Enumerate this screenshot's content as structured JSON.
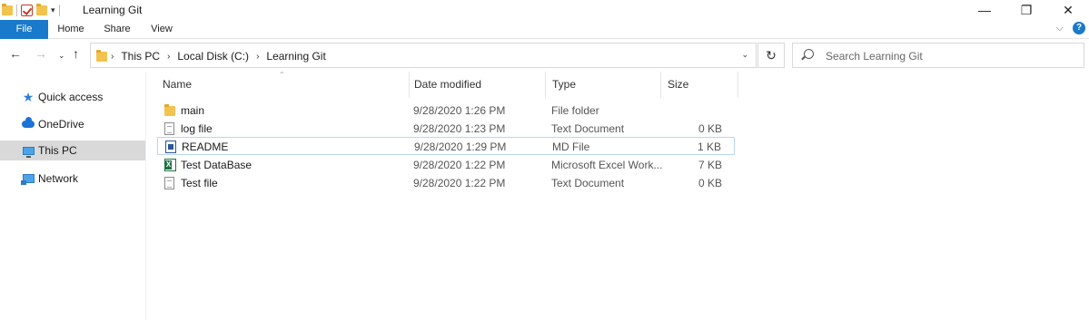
{
  "window": {
    "title": "Learning Git",
    "controls": {
      "minimize": "—",
      "restore": "❐",
      "close": "✕"
    }
  },
  "quick_access_toolbar": {
    "dropdown": "▾"
  },
  "ribbon": {
    "tabs": [
      "File",
      "Home",
      "Share",
      "View"
    ],
    "file_tab_color": "#1979ca",
    "expand_chevron": "⌵",
    "help": "?"
  },
  "navigation": {
    "back": "←",
    "forward": "→",
    "recent": "⌄",
    "up": "↑",
    "breadcrumb": [
      "This PC",
      "Local Disk (C:)",
      "Learning Git"
    ],
    "breadcrumb_separator": "›",
    "address_dropdown": "⌄",
    "refresh": "↻",
    "search_placeholder": "Search Learning Git"
  },
  "sidebar": {
    "items": [
      {
        "label": "Quick access",
        "icon": "star-icon"
      },
      {
        "label": "OneDrive",
        "icon": "cloud-icon"
      },
      {
        "label": "This PC",
        "icon": "computer-icon",
        "selected": true
      },
      {
        "label": "Network",
        "icon": "network-icon"
      }
    ]
  },
  "file_list": {
    "columns": [
      "Name",
      "Date modified",
      "Type",
      "Size"
    ],
    "sort_indicator": "⌃",
    "rows": [
      {
        "name": "main",
        "date": "9/28/2020 1:26 PM",
        "type": "File folder",
        "size": "",
        "icon": "folder-icon"
      },
      {
        "name": "log file",
        "date": "9/28/2020 1:23 PM",
        "type": "Text Document",
        "size": "0 KB",
        "icon": "text-document-icon"
      },
      {
        "name": "README",
        "date": "9/28/2020 1:29 PM",
        "type": "MD File",
        "size": "1 KB",
        "icon": "md-file-icon",
        "highlighted": true
      },
      {
        "name": "Test DataBase",
        "date": "9/28/2020 1:22 PM",
        "type": "Microsoft Excel Work...",
        "size": "7 KB",
        "icon": "excel-file-icon"
      },
      {
        "name": "Test file",
        "date": "9/28/2020 1:22 PM",
        "type": "Text Document",
        "size": "0 KB",
        "icon": "text-document-icon"
      }
    ]
  }
}
